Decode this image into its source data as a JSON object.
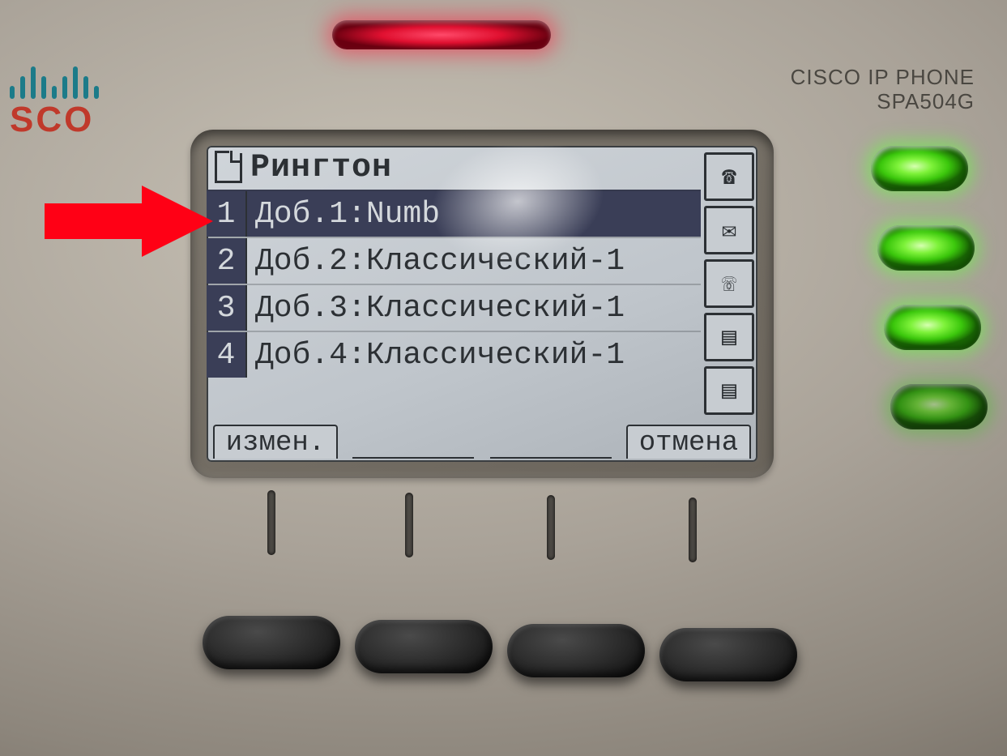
{
  "brand": {
    "word": "SCO",
    "full": "cisco"
  },
  "model": {
    "line1": "CISCO IP PHONE",
    "line2": "SPA504G"
  },
  "screen": {
    "title": "Рингтон",
    "rows": [
      {
        "n": "1",
        "text": "Доб.1:Numb",
        "selected": true
      },
      {
        "n": "2",
        "text": "Доб.2:Классический-1",
        "selected": false
      },
      {
        "n": "3",
        "text": "Доб.3:Классический-1",
        "selected": false
      },
      {
        "n": "4",
        "text": "Доб.4:Классический-1",
        "selected": false
      }
    ],
    "softkeys": [
      {
        "label": "измен.",
        "present": true
      },
      {
        "label": "",
        "present": false
      },
      {
        "label": "",
        "present": false
      },
      {
        "label": "отмена",
        "present": true
      }
    ],
    "side_icons": [
      "phone-offhook-icon",
      "envelope-icon",
      "phone-onhook-icon",
      "directory-icon",
      "directory-icon"
    ]
  },
  "side_icon_glyph": {
    "phone-offhook-icon": "☎",
    "envelope-icon": "✉",
    "phone-onhook-icon": "☏",
    "directory-icon": "▤"
  },
  "leds": [
    {
      "name": "line-1-led"
    },
    {
      "name": "line-2-led"
    },
    {
      "name": "line-3-led"
    },
    {
      "name": "line-4-led"
    }
  ],
  "annotation": {
    "arrow_points_to_row": 1,
    "color": "#ff0015"
  }
}
